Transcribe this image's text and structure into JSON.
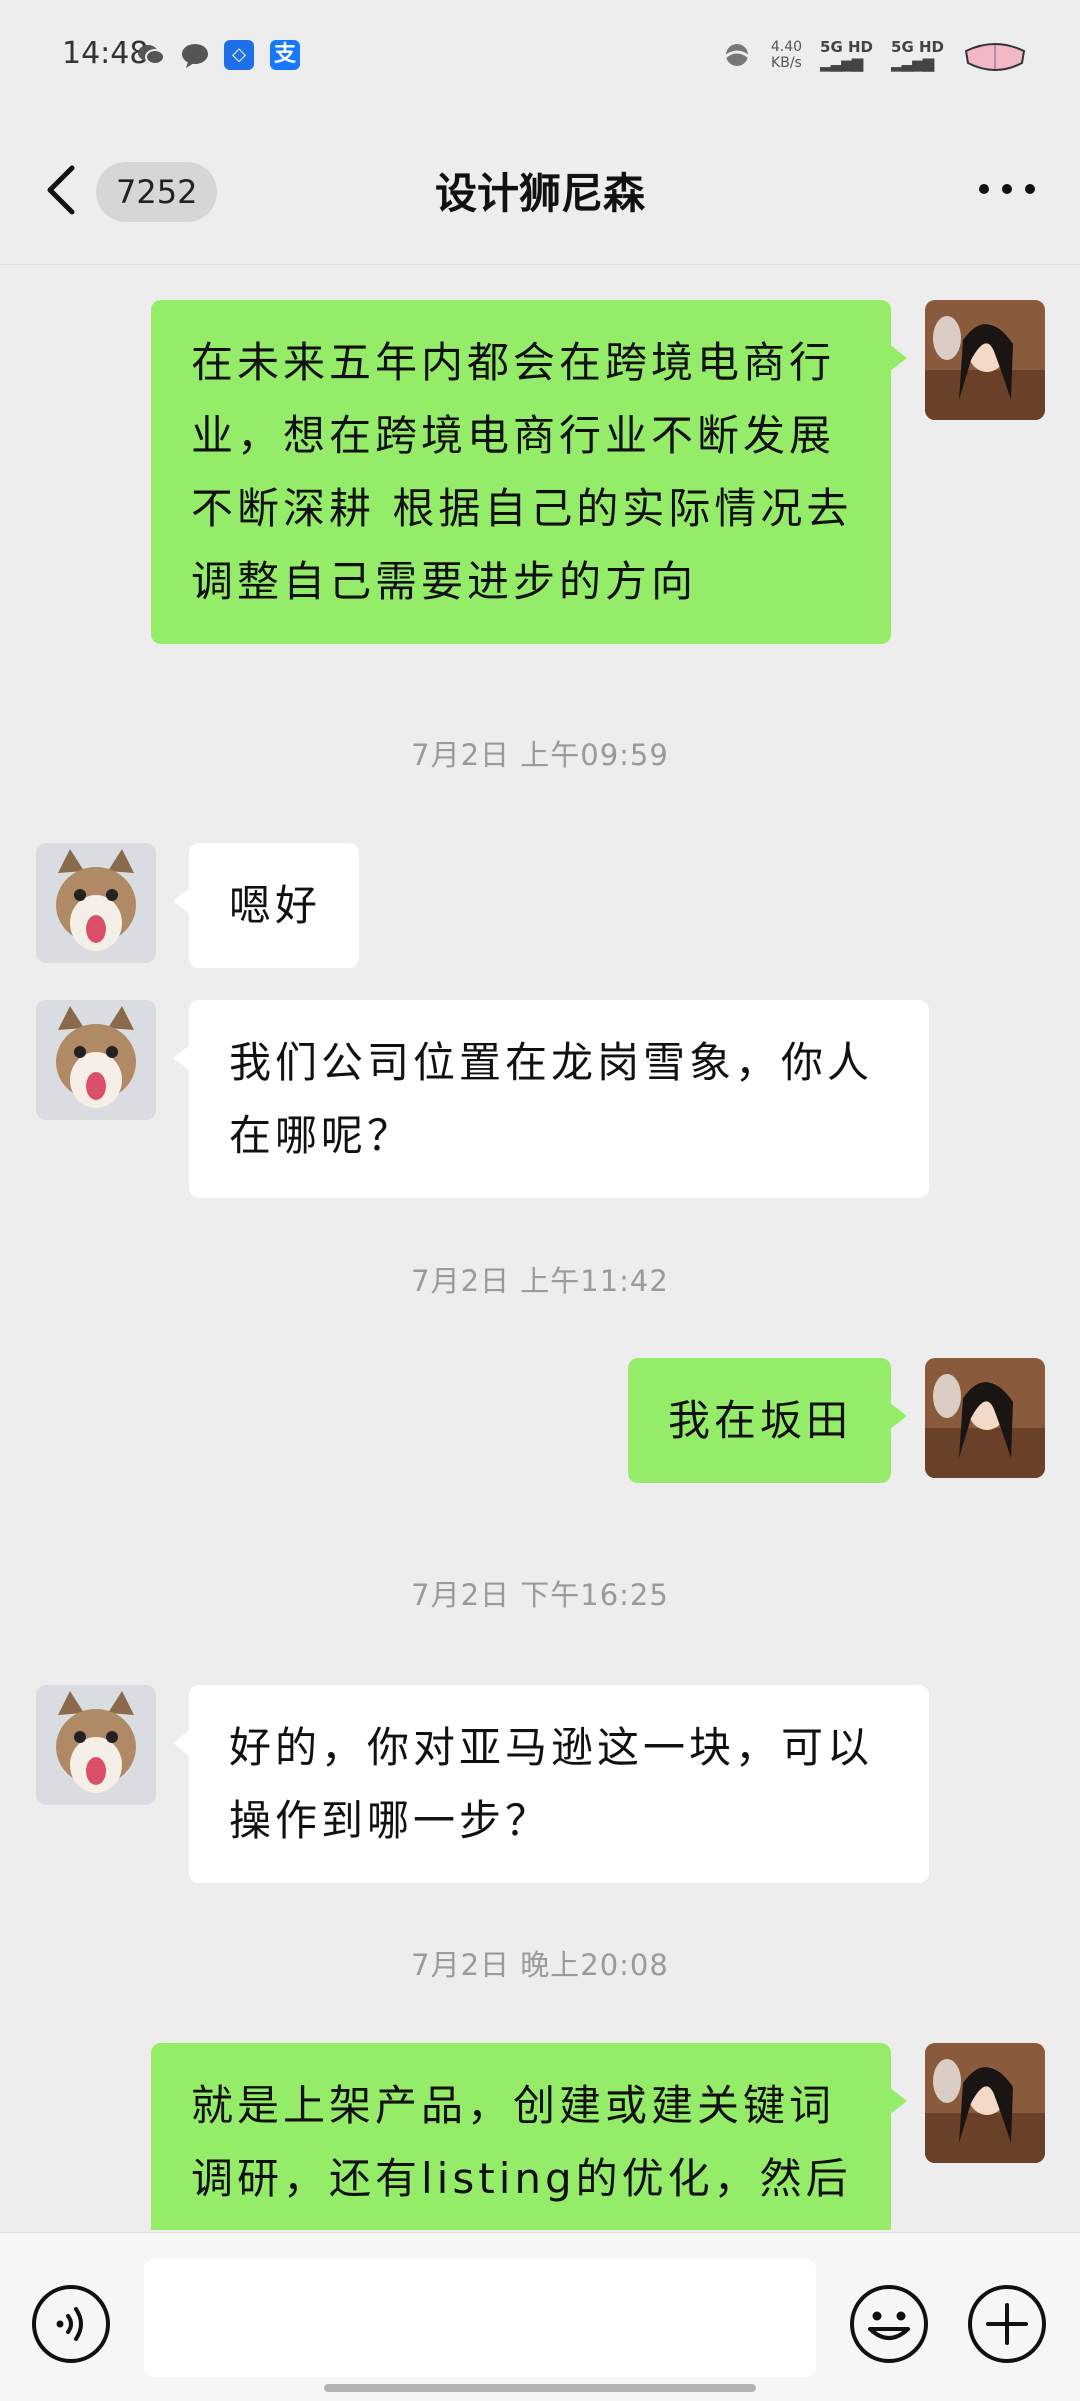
{
  "status_bar": {
    "time": "14:48",
    "net_speed_value": "4.40",
    "net_speed_unit": "KB/s",
    "signal1": "5G HD",
    "signal2": "5G HD",
    "icons": [
      "wechat-icon",
      "message-icon",
      "alipay-blue-icon",
      "alipay-icon",
      "dnd-icon",
      "battery-icon"
    ]
  },
  "header": {
    "unread_count": "7252",
    "title": "设计狮尼森"
  },
  "messages": [
    {
      "side": "sent",
      "text": "在未来五年内都会在跨境电商行业，想在跨境电商行业不断发展不断深耕 根据自己的实际情况去调整自己需要进步的方向"
    },
    {
      "type": "time",
      "text": "7月2日 上午09:59"
    },
    {
      "side": "recv",
      "text": "嗯好"
    },
    {
      "side": "recv",
      "text": "我们公司位置在龙岗雪象，你人在哪呢？"
    },
    {
      "type": "time",
      "text": "7月2日 上午11:42"
    },
    {
      "side": "sent",
      "text": "我在坂田"
    },
    {
      "type": "time",
      "text": "7月2日 下午16:25"
    },
    {
      "side": "recv",
      "text": "好的，你对亚马逊这一块，可以操作到哪一步？"
    },
    {
      "type": "time",
      "text": "7月2日 晚上20:08"
    },
    {
      "side": "sent",
      "text": "就是上架产品，创建或建关键词调研，还有listing的优化，然后回"
    }
  ],
  "input": {
    "placeholder": ""
  },
  "colors": {
    "sent_bubble": "#95ec69",
    "recv_bubble": "#ffffff",
    "background": "#ededed"
  }
}
